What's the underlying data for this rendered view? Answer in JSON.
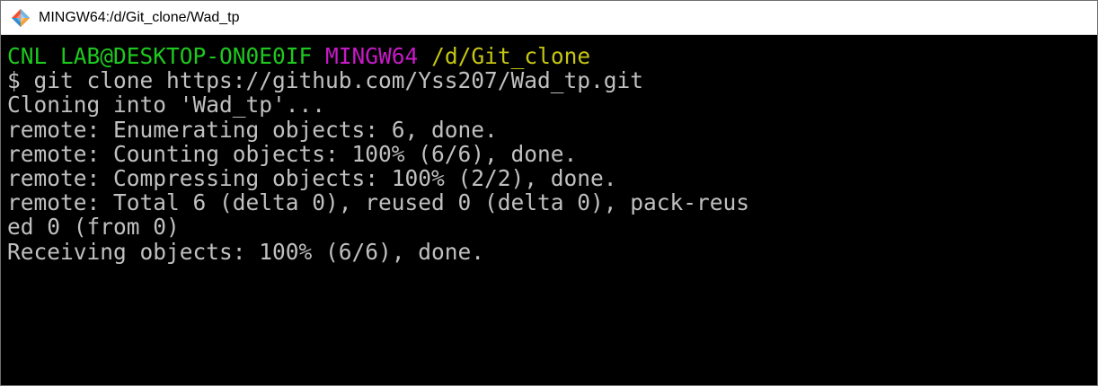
{
  "window": {
    "title": "MINGW64:/d/Git_clone/Wad_tp",
    "icon": "git-bash-icon"
  },
  "terminal": {
    "prompt": {
      "user_host": "CNL LAB@DESKTOP-ON0E0IF",
      "env": "MINGW64",
      "path": "/d/Git_clone"
    },
    "command": "$ git clone https://github.com/Yss207/Wad_tp.git",
    "output": [
      "Cloning into 'Wad_tp'...",
      "remote: Enumerating objects: 6, done.",
      "remote: Counting objects: 100% (6/6), done.",
      "remote: Compressing objects: 100% (2/2), done.",
      "remote: Total 6 (delta 0), reused 0 (delta 0), pack-reus",
      "ed 0 (from 0)",
      "Receiving objects: 100% (6/6), done."
    ],
    "colors": {
      "background": "#000000",
      "text": "#c0c0c0",
      "user_host": "#1ec91e",
      "env": "#c71ac7",
      "path": "#c5c514"
    }
  }
}
